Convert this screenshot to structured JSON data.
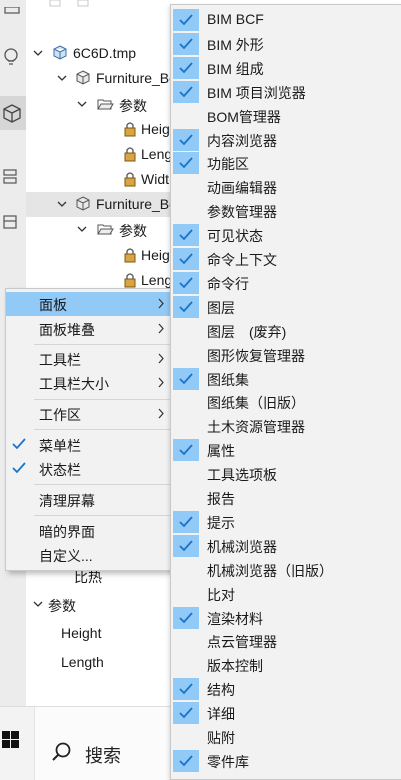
{
  "tree": {
    "rows": [
      {
        "label": "6C6D.tmp",
        "icon": "component-cube-icon",
        "expanded": true,
        "selected": false
      },
      {
        "label": "Furniture_Bo",
        "icon": "component-cube-icon",
        "expanded": true,
        "selected": false
      },
      {
        "label": "参数",
        "icon": "folder-open-icon",
        "expanded": true,
        "selected": false
      },
      {
        "label": "Heig",
        "icon": "parameter-lock-icon",
        "expanded": null,
        "selected": false
      },
      {
        "label": "Leng",
        "icon": "parameter-lock-icon",
        "expanded": null,
        "selected": false
      },
      {
        "label": "Widt",
        "icon": "parameter-lock-icon",
        "expanded": null,
        "selected": false
      },
      {
        "label": "Furniture_Bo",
        "icon": "component-cube-icon",
        "expanded": true,
        "selected": true
      },
      {
        "label": "参数",
        "icon": "folder-open-icon",
        "expanded": true,
        "selected": false
      },
      {
        "label": "Heig",
        "icon": "parameter-lock-icon",
        "expanded": null,
        "selected": false
      },
      {
        "label": "Leng",
        "icon": "parameter-lock-icon",
        "expanded": null,
        "selected": false
      }
    ],
    "lower_rows": [
      {
        "label": "比热",
        "indent": "deep"
      },
      {
        "label": "参数",
        "indent": "folder"
      },
      {
        "label": "Height",
        "indent": "item"
      },
      {
        "label": "Length",
        "indent": "item"
      }
    ]
  },
  "context_menu": {
    "items": [
      {
        "label": "面板",
        "submenu": true,
        "checked": false,
        "highlighted": true
      },
      {
        "label": "面板堆叠",
        "submenu": true,
        "checked": false,
        "highlighted": false
      },
      {
        "label": "工具栏",
        "submenu": true,
        "checked": false,
        "highlighted": false
      },
      {
        "label": "工具栏大小",
        "submenu": true,
        "checked": false,
        "highlighted": false
      },
      {
        "label": "工作区",
        "submenu": true,
        "checked": false,
        "highlighted": false
      },
      {
        "label": "菜单栏",
        "submenu": false,
        "checked": true,
        "highlighted": false
      },
      {
        "label": "状态栏",
        "submenu": false,
        "checked": true,
        "highlighted": false
      },
      {
        "label": "清理屏幕",
        "submenu": false,
        "checked": false,
        "highlighted": false
      },
      {
        "label": "暗的界面",
        "submenu": false,
        "checked": false,
        "highlighted": false
      },
      {
        "label": "自定义...",
        "submenu": false,
        "checked": false,
        "highlighted": false
      }
    ]
  },
  "panels_submenu": {
    "items": [
      {
        "label": "BIM BCF",
        "checked": true
      },
      {
        "label": "BIM 外形",
        "checked": true
      },
      {
        "label": "BIM 组成",
        "checked": true
      },
      {
        "label": "BIM 项目浏览器",
        "checked": true
      },
      {
        "label": "BOM管理器",
        "checked": false
      },
      {
        "label": "内容浏览器",
        "checked": true
      },
      {
        "label": "功能区",
        "checked": true
      },
      {
        "label": "动画编辑器",
        "checked": false
      },
      {
        "label": "参数管理器",
        "checked": false
      },
      {
        "label": "可见状态",
        "checked": true
      },
      {
        "label": "命令上下文",
        "checked": true
      },
      {
        "label": "命令行",
        "checked": true
      },
      {
        "label": "图层",
        "checked": true
      },
      {
        "label": "图层　(废弃)",
        "checked": false
      },
      {
        "label": "图形恢复管理器",
        "checked": false
      },
      {
        "label": "图纸集",
        "checked": true
      },
      {
        "label": "图纸集（旧版）",
        "checked": false
      },
      {
        "label": "土木资源管理器",
        "checked": false
      },
      {
        "label": "属性",
        "checked": true
      },
      {
        "label": "工具选项板",
        "checked": false
      },
      {
        "label": "报告",
        "checked": false
      },
      {
        "label": "提示",
        "checked": true
      },
      {
        "label": "机械浏览器",
        "checked": true
      },
      {
        "label": "机械浏览器（旧版）",
        "checked": false
      },
      {
        "label": "比对",
        "checked": false
      },
      {
        "label": "渲染材料",
        "checked": true
      },
      {
        "label": "点云管理器",
        "checked": false
      },
      {
        "label": "版本控制",
        "checked": false
      },
      {
        "label": "结构",
        "checked": true
      },
      {
        "label": "详细",
        "checked": true
      },
      {
        "label": "贴附",
        "checked": false
      },
      {
        "label": "零件库",
        "checked": true
      }
    ]
  },
  "taskbar": {
    "start_icon": "windows-logo-icon",
    "search_label": "搜索"
  },
  "colors": {
    "highlight": "#91c9f7",
    "check": "#1a73c8",
    "menu_bg": "#f2f2f2"
  }
}
